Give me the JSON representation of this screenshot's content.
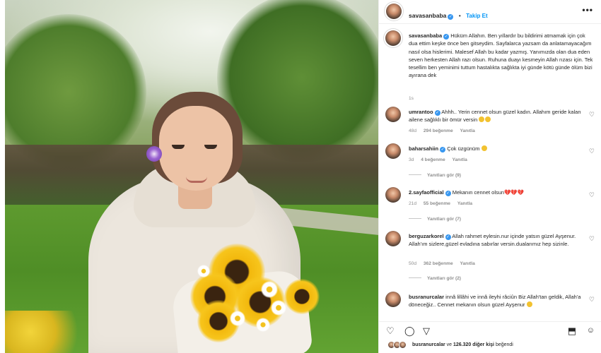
{
  "post": {
    "author": "savasanbaba",
    "separator": "•",
    "follow_label": "Takip Et",
    "more_label": "•••",
    "caption": "Hüküm Allahın. Ben yıllardır bu bildirimi atmamak için çok dua ettim keşke önce ben gitseydim. Sayfalarca yazsam da anlatamayacağım nasıl olsa hislerimi. Malesef Allah bu kadar yazmış. Yanımızda olan dua eden seven herkesten Allah razı olsun. Ruhuna duayı kesmeyin Allah rızası için. Tek tesellim ben yeminimi tuttum hastalıkta sağlıkta iyi günde kötü günde ölüm bizi ayırana dek",
    "caption_time": "1s"
  },
  "comments": [
    {
      "user": "umrantoo",
      "verified": true,
      "text": "Ahhh.. Yerin cennet olsun güzel kadın. Allahım geride kalan ailene sağlıklı bir ömür versin",
      "time": "48d",
      "likes": "294 beğenme",
      "reply": "Yanıtla",
      "heart": "♡"
    },
    {
      "user": "baharsahiin",
      "verified": true,
      "text": "Çok üzgünüm",
      "time": "3d",
      "likes": "4 beğenme",
      "reply": "Yanıtla",
      "view_replies": "Yanıtları gör (9)",
      "heart": "♡"
    },
    {
      "user": "2.sayfaofficial",
      "verified": true,
      "text": "Mekanın cennet olsun💔💔💔",
      "time": "21d",
      "likes": "55 beğenme",
      "reply": "Yanıtla",
      "view_replies": "Yanıtları gör (7)",
      "heart": "♡"
    },
    {
      "user": "berguzarkorel",
      "verified": true,
      "text": "Allah rahmet eylesin.nur içinde yatsın güzel Ayşenur. Allah'ım sizlere,güzel evladına sabırlar versin.dualarımız hep sizinle.",
      "time": "50d",
      "likes": "362 beğenme",
      "reply": "Yanıtla",
      "view_replies": "Yanıtları gör (2)",
      "heart": "♡"
    },
    {
      "user": "busranurcalar",
      "verified": false,
      "text": "innâ lillâhi ve innâ ileyhi râciûn Biz Allah'tan geldik, Allah'a döneceğiz.. Cennet mekanın olsun güzel Ayşenur",
      "heart": "♡"
    }
  ],
  "actions": {
    "like_icon": "♡",
    "comment_icon": "◯",
    "share_icon": "▽",
    "save_icon": "⬒"
  },
  "likes_line": {
    "user": "busranurcalar",
    "connector": "ve",
    "count_text": "126.320 diğer kişi",
    "suffix": "beğendi"
  },
  "colors": {
    "accent": "#0095f6",
    "verified": "#3897f0",
    "muted": "#8e8e8e"
  }
}
